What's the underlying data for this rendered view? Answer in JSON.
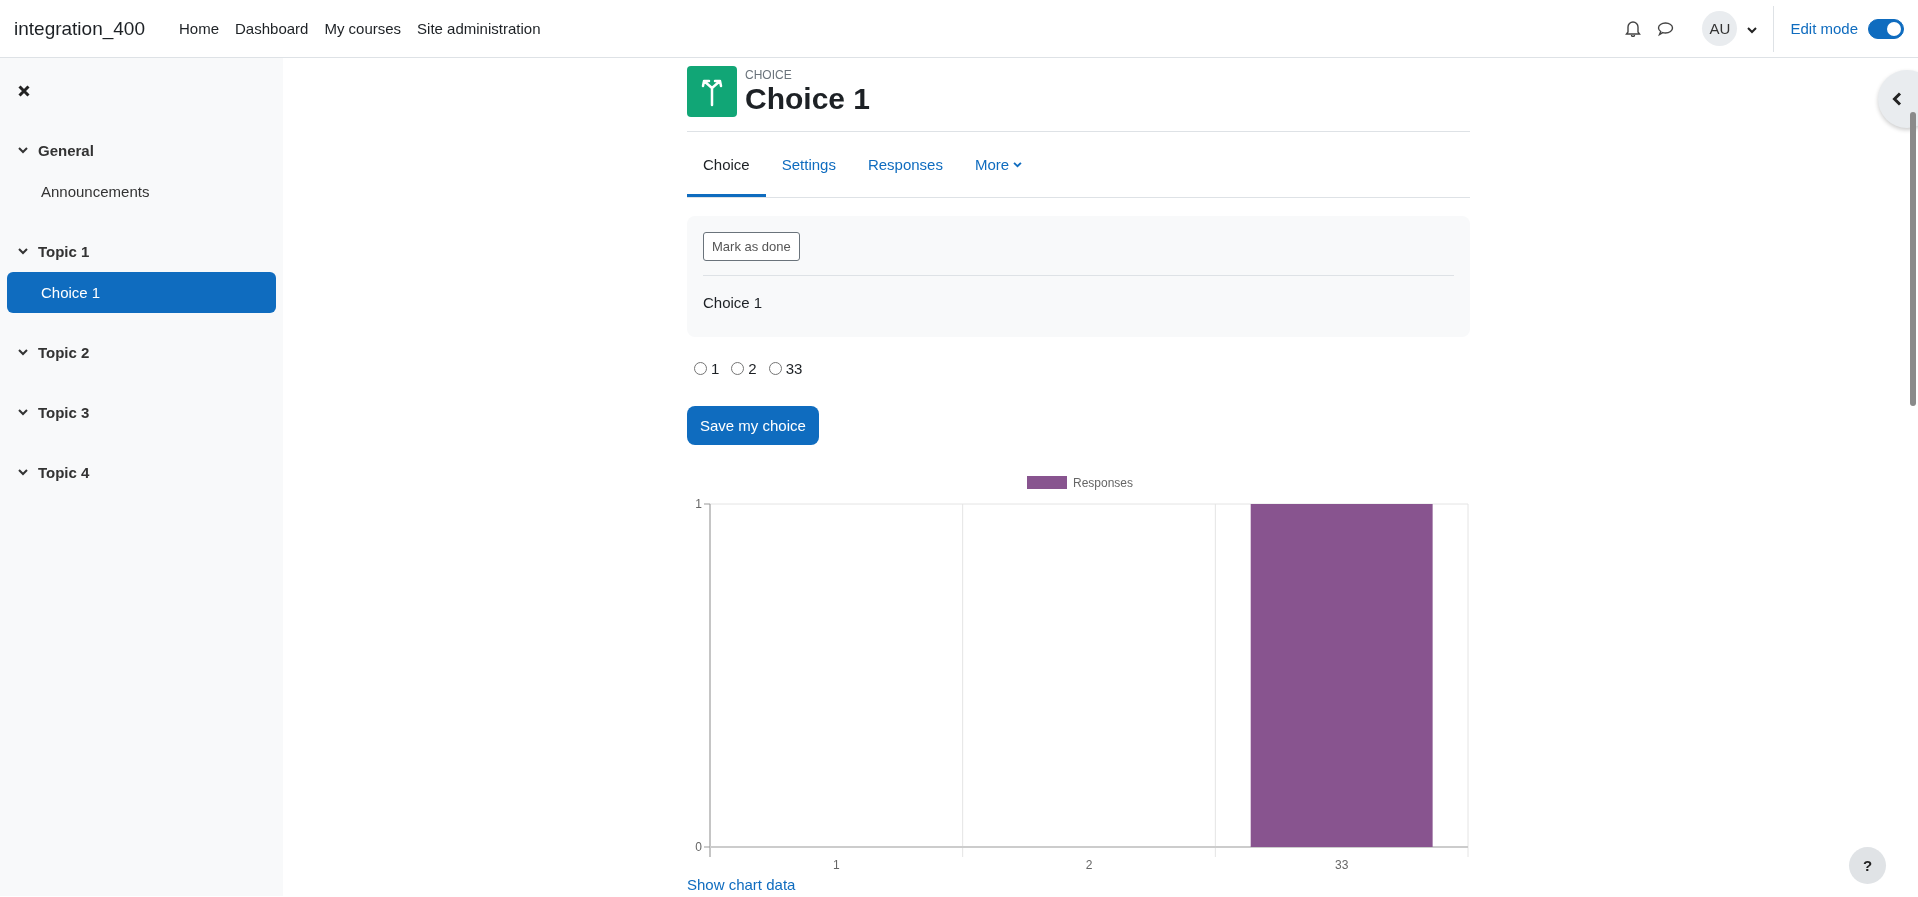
{
  "navbar": {
    "site_name": "integration_400",
    "links": [
      {
        "label": "Home"
      },
      {
        "label": "Dashboard"
      },
      {
        "label": "My courses"
      },
      {
        "label": "Site administration"
      }
    ],
    "user_initials": "AU",
    "edit_mode": {
      "label": "Edit mode",
      "on": true
    }
  },
  "sidebar": {
    "sections": [
      {
        "label": "General",
        "expanded": true,
        "selected": false,
        "children": [
          {
            "label": "Announcements",
            "selected": false
          }
        ]
      },
      {
        "label": "Topic 1",
        "expanded": true,
        "selected": false,
        "children": [
          {
            "label": "Choice 1",
            "selected": true
          }
        ]
      },
      {
        "label": "Topic 2",
        "expanded": true,
        "selected": false
      },
      {
        "label": "Topic 3",
        "expanded": true,
        "selected": false
      },
      {
        "label": "Topic 4",
        "expanded": true,
        "selected": false
      }
    ]
  },
  "activity": {
    "type_label": "CHOICE",
    "title": "Choice 1"
  },
  "tabs": [
    {
      "label": "Choice",
      "selected": true,
      "kind": "link"
    },
    {
      "label": "Settings",
      "selected": false,
      "kind": "link"
    },
    {
      "label": "Responses",
      "selected": false,
      "kind": "link"
    },
    {
      "label": "More",
      "selected": false,
      "kind": "menu"
    }
  ],
  "completion_button": "Mark as done",
  "description": "Choice 1",
  "options": [
    {
      "label": "1",
      "selected": false
    },
    {
      "label": "2",
      "selected": false
    },
    {
      "label": "33",
      "selected": false
    }
  ],
  "save_button": "Save my choice",
  "chart_data": {
    "type": "bar",
    "categories": [
      "1",
      "2",
      "33"
    ],
    "series": [
      {
        "name": "Responses",
        "color": "#88548f",
        "values": [
          0,
          0,
          1
        ]
      }
    ],
    "ylim": [
      0,
      1
    ],
    "yticks": [
      0,
      1
    ]
  },
  "show_chart_data_link": "Show chart data",
  "help_button": "?"
}
